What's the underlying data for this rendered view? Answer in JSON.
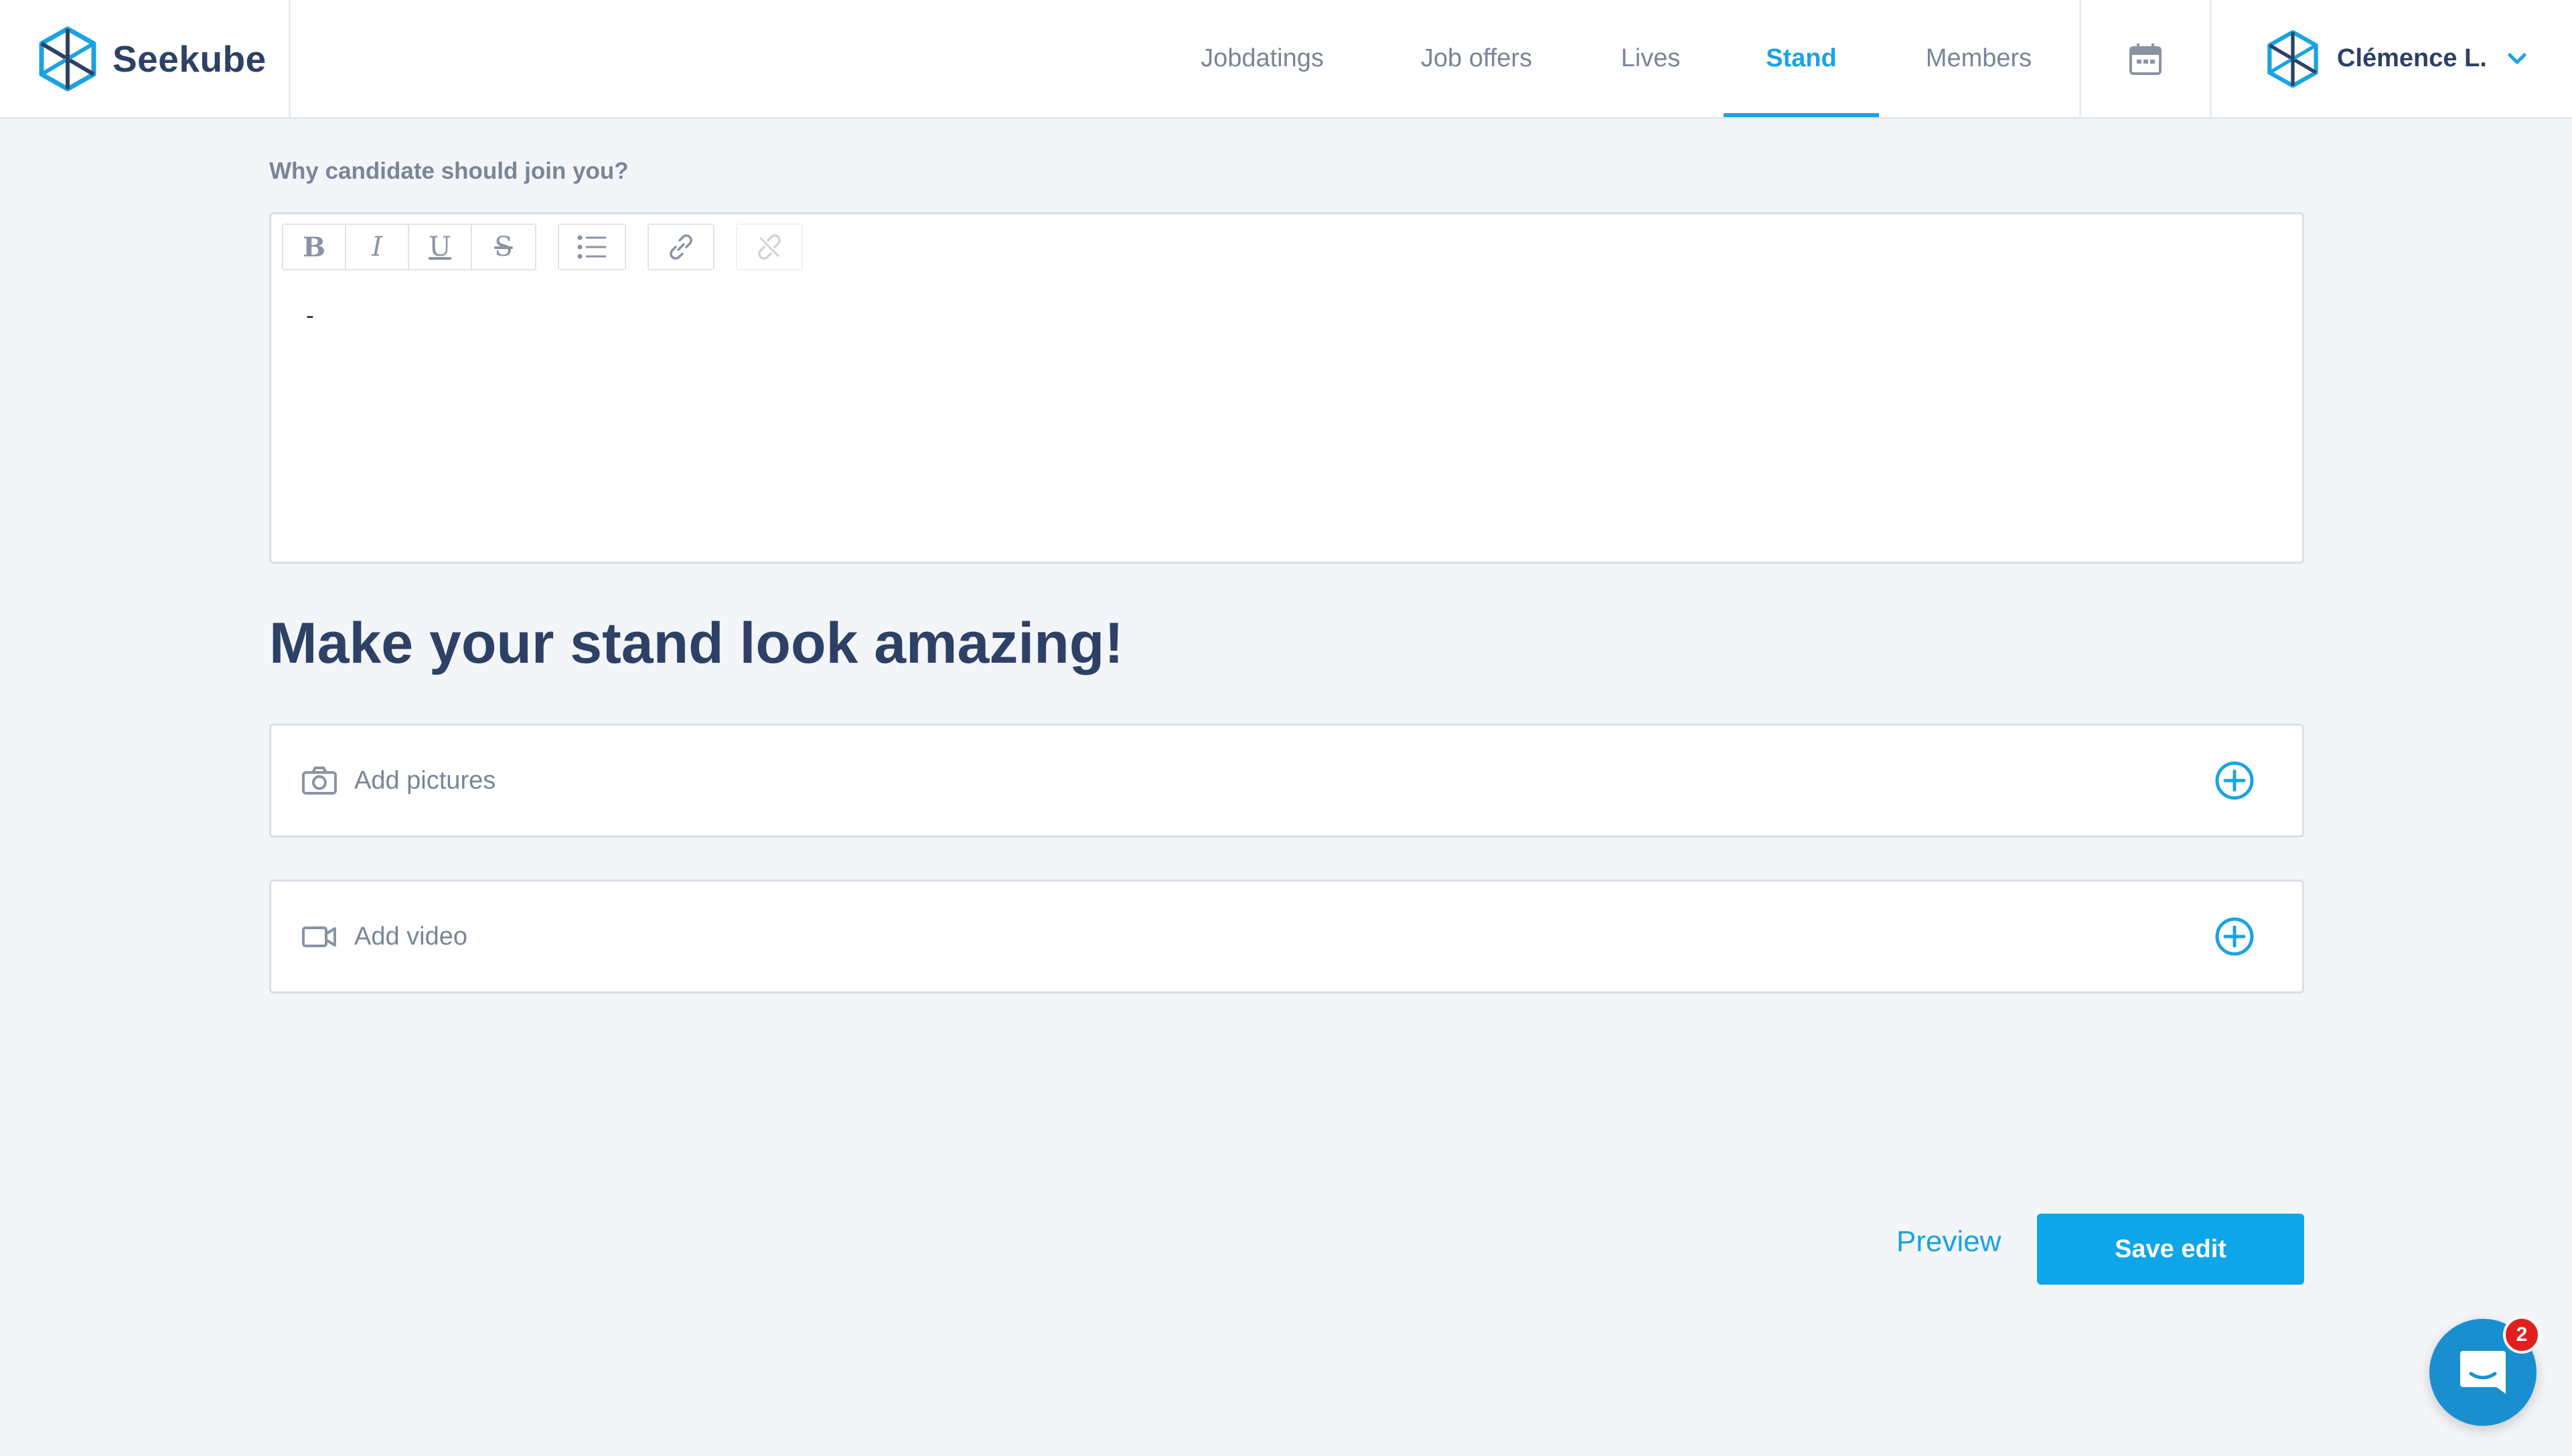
{
  "brand": {
    "name": "Seekube",
    "accent": "#1aa3e1",
    "dark": "#2d4166"
  },
  "nav": {
    "items": [
      {
        "label": "Jobdatings"
      },
      {
        "label": "Job offers"
      },
      {
        "label": "Lives"
      },
      {
        "label": "Stand",
        "active": true
      },
      {
        "label": "Members"
      }
    ],
    "calendar_icon": "calendar-icon"
  },
  "user": {
    "name": "Clémence L.",
    "menu_icon": "chevron-down-icon"
  },
  "form": {
    "why_join_label": "Why candidate should join you?",
    "editor_text": "-",
    "toolbar": [
      "bold",
      "italic",
      "underline",
      "strikethrough",
      "bullet-list",
      "link",
      "unlink"
    ]
  },
  "section": {
    "title": "Make your stand look amazing!"
  },
  "media": {
    "pictures_label": "Add pictures",
    "video_label": "Add video"
  },
  "actions": {
    "preview_label": "Preview",
    "save_label": "Save edit"
  },
  "chat": {
    "badge_count": "2"
  }
}
